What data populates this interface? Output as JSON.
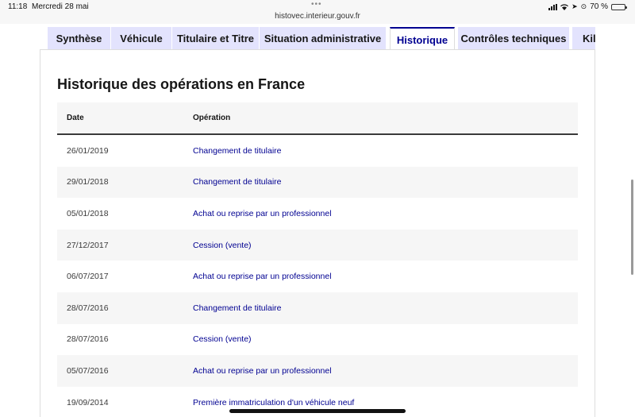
{
  "status_bar": {
    "time": "11:18",
    "date": "Mercredi 28 mai",
    "url": "histovec.interieur.gouv.fr",
    "battery": "70 %",
    "battery_level": 0.7
  },
  "tabs": [
    {
      "label": "Synthèse",
      "active": false
    },
    {
      "label": "Véhicule",
      "active": false
    },
    {
      "label": "Titulaire et Titre",
      "active": false
    },
    {
      "label": "Situation administrative",
      "active": false
    },
    {
      "label": "Historique",
      "active": true
    },
    {
      "label": "Contrôles techniques",
      "active": false
    },
    {
      "label": "Kilo",
      "active": false
    }
  ],
  "main": {
    "title": "Historique des opérations en France",
    "table": {
      "headers": {
        "date": "Date",
        "operation": "Opération"
      },
      "rows": [
        {
          "date": "26/01/2019",
          "operation": "Changement de titulaire"
        },
        {
          "date": "29/01/2018",
          "operation": "Changement de titulaire"
        },
        {
          "date": "05/01/2018",
          "operation": "Achat ou reprise par un professionnel"
        },
        {
          "date": "27/12/2017",
          "operation": "Cession (vente)"
        },
        {
          "date": "06/07/2017",
          "operation": "Achat ou reprise par un professionnel"
        },
        {
          "date": "28/07/2016",
          "operation": "Changement de titulaire"
        },
        {
          "date": "28/07/2016",
          "operation": "Cession (vente)"
        },
        {
          "date": "05/07/2016",
          "operation": "Achat ou reprise par un professionnel"
        },
        {
          "date": "19/09/2014",
          "operation": "Première immatriculation d'un véhicule neuf"
        }
      ]
    }
  },
  "colors": {
    "accent": "#000091",
    "tab_bg": "#e3e3fd",
    "row_alt": "#f6f6f6"
  }
}
